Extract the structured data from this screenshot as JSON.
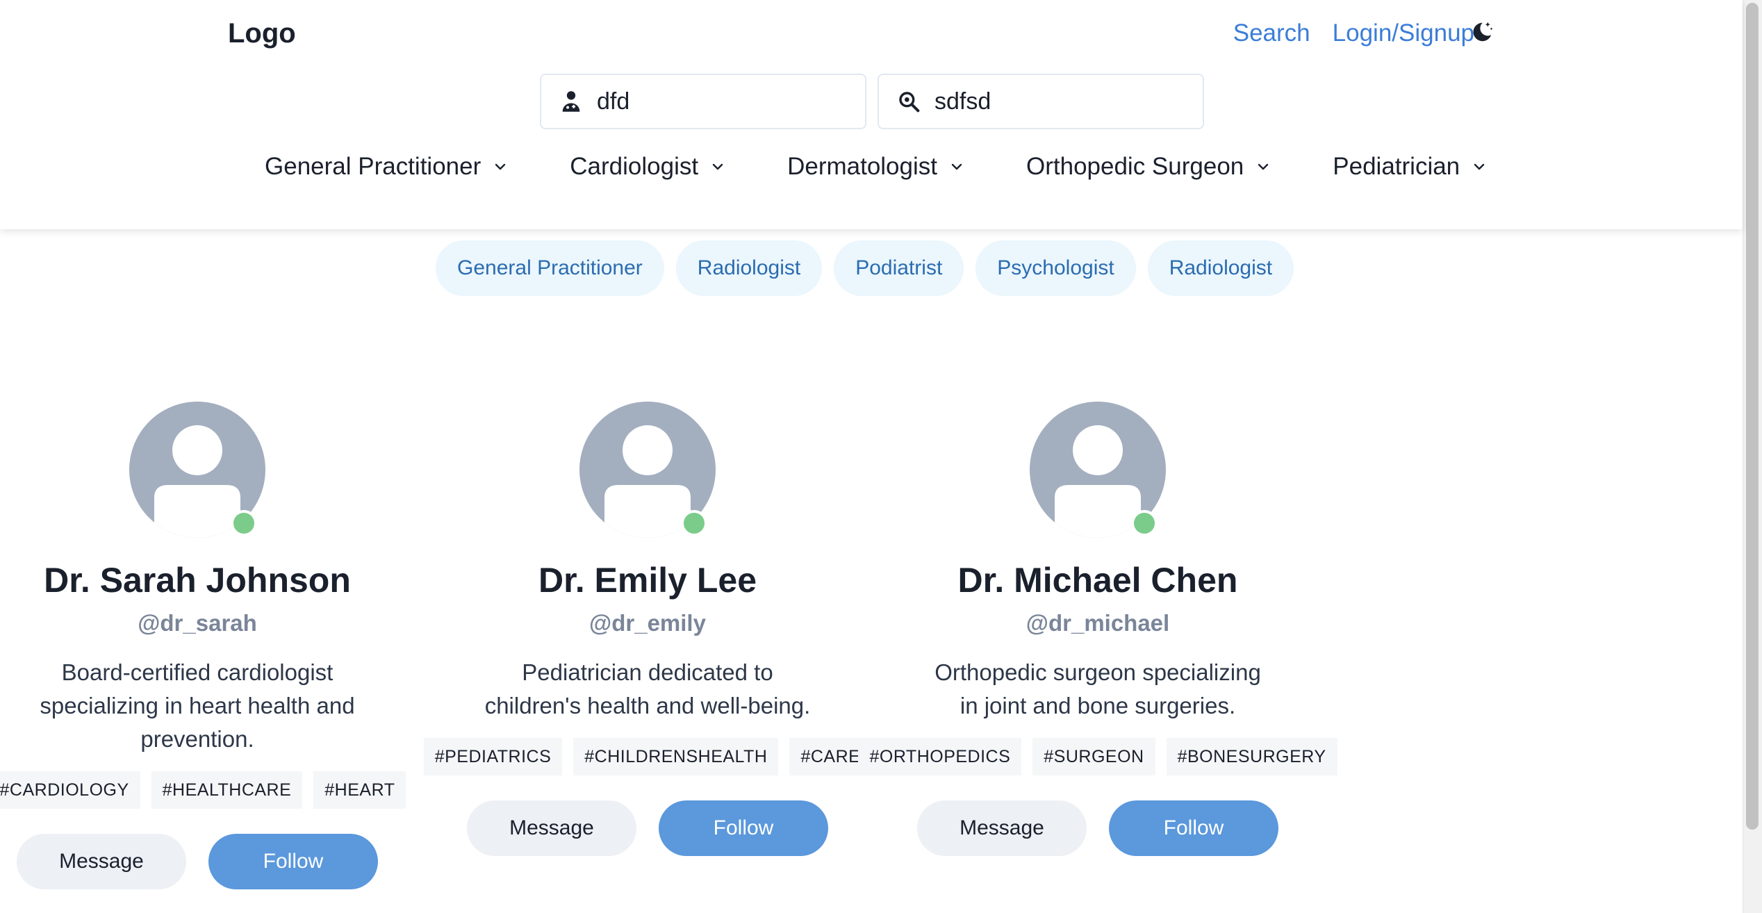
{
  "header": {
    "logo": "Logo",
    "search_link": "Search",
    "login_link": "Login/Signup",
    "theme_icon": "moon-sparkle-icon"
  },
  "search": {
    "doctor_value": "dfd",
    "doctor_icon": "doctor-icon",
    "query_value": "sdfsd",
    "query_icon": "magnifier-icon"
  },
  "categories": [
    {
      "label": "General Practitioner"
    },
    {
      "label": "Cardiologist"
    },
    {
      "label": "Dermatologist"
    },
    {
      "label": "Orthopedic Surgeon"
    },
    {
      "label": "Pediatrician"
    }
  ],
  "pills": [
    {
      "label": "General Practitioner"
    },
    {
      "label": "Radiologist"
    },
    {
      "label": "Podiatrist"
    },
    {
      "label": "Psychologist"
    },
    {
      "label": "Radiologist"
    }
  ],
  "doctors": [
    {
      "name": "Dr. Sarah Johnson",
      "handle": "@dr_sarah",
      "bio_line1": "Board-certified cardiologist",
      "bio_line2": "specializing in heart health and",
      "bio_line3": "prevention.",
      "tags": [
        "#CARDIOLOGY",
        "#HEALTHCARE",
        "#HEART"
      ],
      "message_label": "Message",
      "follow_label": "Follow"
    },
    {
      "name": "Dr. Emily Lee",
      "handle": "@dr_emily",
      "bio_line1": "Pediatrician dedicated to",
      "bio_line2": "children's health and well-being.",
      "bio_line3": "",
      "tags": [
        "#PEDIATRICS",
        "#CHILDRENSHEALTH",
        "#CARE"
      ],
      "message_label": "Message",
      "follow_label": "Follow"
    },
    {
      "name": "Dr. Michael Chen",
      "handle": "@dr_michael",
      "bio_line1": "Orthopedic surgeon specializing",
      "bio_line2": "in joint and bone surgeries.",
      "bio_line3": "",
      "tags": [
        "#ORTHOPEDICS",
        "#SURGEON",
        "#BONESURGERY"
      ],
      "message_label": "Message",
      "follow_label": "Follow"
    }
  ],
  "colors": {
    "link": "#3b7dd8",
    "pill_bg": "#ebf6fd",
    "pill_text": "#2b6cb0",
    "avatar": "#a3afbf",
    "online": "#7bcc8a",
    "follow_bg": "#5b98dc",
    "message_bg": "#edf0f4"
  }
}
